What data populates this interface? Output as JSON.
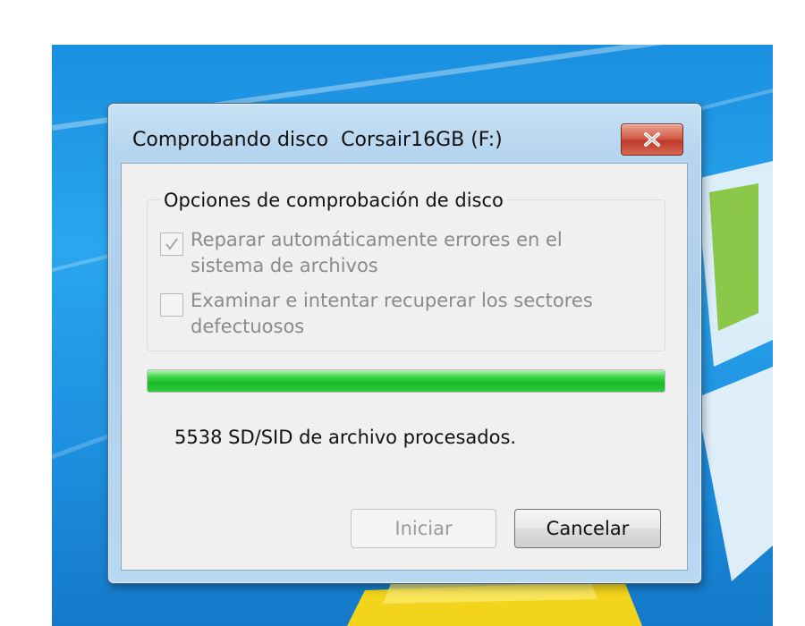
{
  "window": {
    "title": "Comprobando disco  Corsair16GB (F:)",
    "close_icon": "close-x-icon"
  },
  "group": {
    "legend": "Opciones de comprobación de disco",
    "options": [
      {
        "label": "Reparar automáticamente errores en el sistema de archivos",
        "checked": true,
        "enabled": false
      },
      {
        "label": "Examinar e intentar recuperar los sectores defectuosos",
        "checked": false,
        "enabled": false
      }
    ]
  },
  "progress": {
    "fraction": 1.0,
    "color": "#22c32f"
  },
  "status_text": "5538 SD/SID de archivo procesados.",
  "buttons": {
    "start": "Iniciar",
    "cancel": "Cancelar"
  },
  "colors": {
    "desktop": "#1d8fdf",
    "close_button": "#c0392b",
    "dialog_frame": "#b6d5ef"
  }
}
